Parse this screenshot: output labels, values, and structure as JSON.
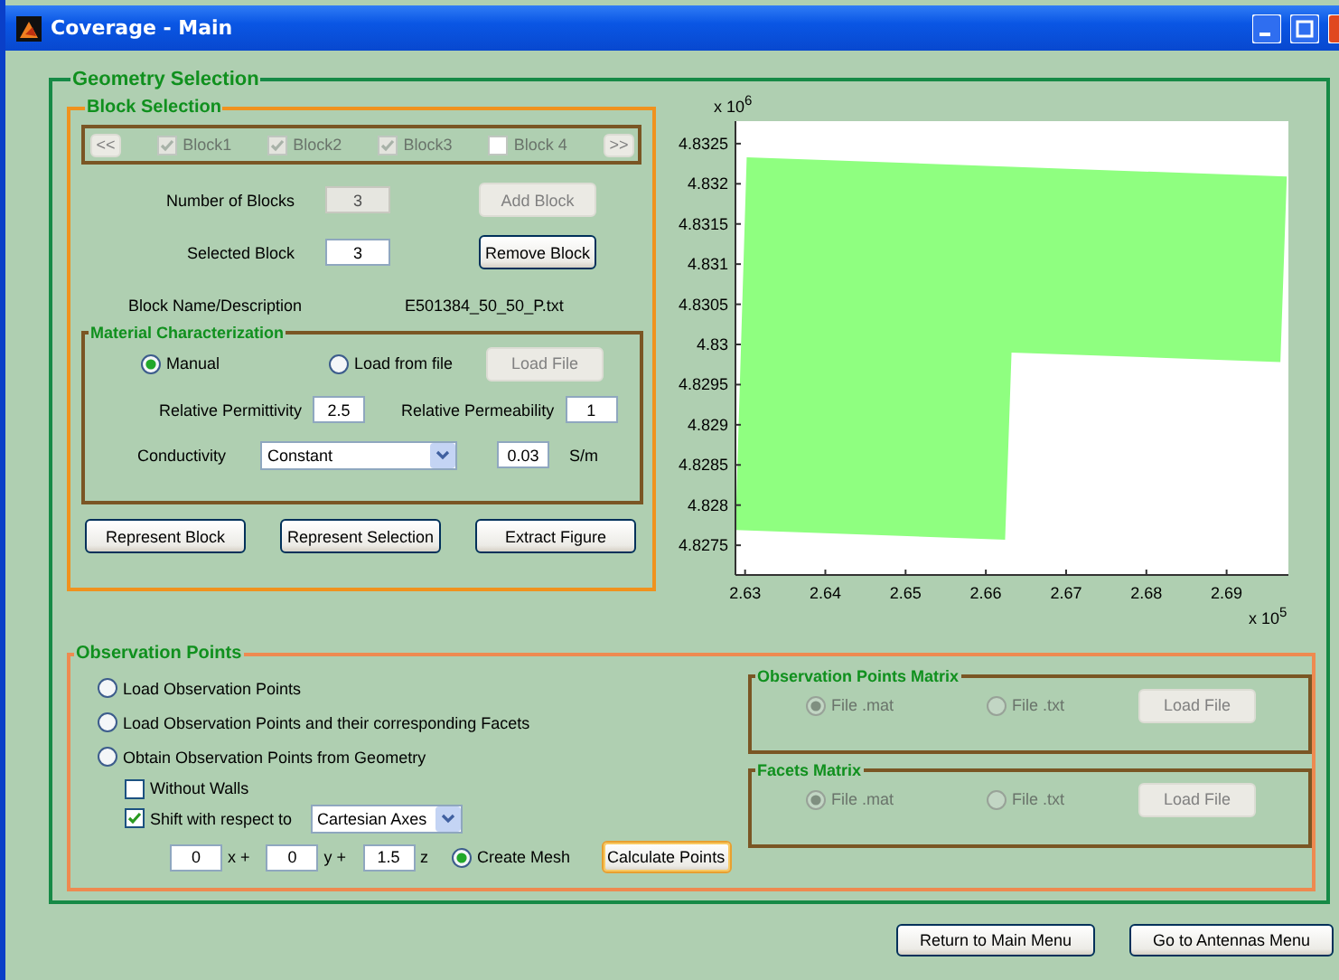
{
  "window": {
    "title": "Coverage - Main"
  },
  "geometry": {
    "title": "Geometry Selection",
    "block_selection": {
      "title": "Block Selection",
      "nav": {
        "prev": "<<",
        "next": ">>",
        "disabled": true
      },
      "blocks": [
        {
          "label": "Block1",
          "checked": true,
          "disabled": true
        },
        {
          "label": "Block2",
          "checked": true,
          "disabled": true
        },
        {
          "label": "Block3",
          "checked": true,
          "disabled": true
        },
        {
          "label": "Block 4",
          "checked": false,
          "disabled": true
        }
      ],
      "number_of_blocks": {
        "label": "Number of Blocks",
        "value": "3",
        "disabled": true
      },
      "add_block": {
        "label": "Add Block",
        "disabled": true
      },
      "selected_block": {
        "label": "Selected Block",
        "value": "3"
      },
      "remove_block": {
        "label": "Remove Block",
        "disabled": false
      },
      "block_name": {
        "label": "Block Name/Description",
        "value": "E501384_50_50_P.txt"
      },
      "material": {
        "title": "Material Characterization",
        "options": [
          {
            "label": "Manual",
            "selected": true
          },
          {
            "label": "Load from file",
            "selected": false
          }
        ],
        "load_file": {
          "label": "Load File",
          "disabled": true
        },
        "permittivity": {
          "label": "Relative Permittivity",
          "value": "2.5"
        },
        "permeability": {
          "label": "Relative Permeability",
          "value": "1"
        },
        "conductivity": {
          "label": "Conductivity",
          "mode": "Constant",
          "value": "0.03",
          "unit": "S/m"
        }
      },
      "buttons": [
        "Represent Block",
        "Represent Selection",
        "Extract Figure"
      ]
    },
    "plot": {
      "chart_data": {
        "type": "area",
        "x": [
          2.6302,
          2.6975,
          2.6967,
          2.6632,
          2.6624,
          2.6288
        ],
        "series": [
          {
            "color": "#8fff80",
            "values": [
              4.83233,
              4.83209,
              4.82978,
              4.8299,
              4.82757,
              4.82769
            ]
          }
        ],
        "xlim": [
          2.6288,
          2.6977
        ],
        "ylim": [
          4.82713,
          4.83278
        ],
        "xticks": [
          2.63,
          2.64,
          2.65,
          2.66,
          2.67,
          2.68,
          2.69
        ],
        "yticks": [
          4.8275,
          4.828,
          4.8285,
          4.829,
          4.8295,
          4.83,
          4.8305,
          4.831,
          4.8315,
          4.832,
          4.8325
        ],
        "annotations": [
          {
            "text": "x 10$^{6}$"
          },
          {
            "text": "x 10$^{5}$"
          }
        ]
      }
    },
    "observation": {
      "title": "Observation Points",
      "options": [
        {
          "label": "Load Observation Points",
          "selected": false
        },
        {
          "label": "Load Observation Points and their corresponding Facets",
          "selected": false
        },
        {
          "label": "Obtain Observation Points from Geometry",
          "selected": false
        }
      ],
      "without_walls": {
        "label": "Without Walls",
        "checked": false
      },
      "shift": {
        "label": "Shift with respect to",
        "checked": true,
        "axes": "Cartesian Axes"
      },
      "coords": [
        {
          "value": "0",
          "label": "x +"
        },
        {
          "value": "0",
          "label": "y +"
        },
        {
          "value": "1.5",
          "label": "z"
        }
      ],
      "create_mesh": {
        "label": "Create Mesh",
        "selected": true
      },
      "calculate": {
        "label": "Calculate Points",
        "focused": true
      },
      "matrices": [
        {
          "title": "Observation Points Matrix",
          "disabled": true,
          "options": [
            {
              "label": "File .mat",
              "selected": true
            },
            {
              "label": "File .txt",
              "selected": false
            }
          ],
          "button": "Load File"
        },
        {
          "title": "Facets Matrix",
          "disabled": true,
          "options": [
            {
              "label": "File .mat",
              "selected": true
            },
            {
              "label": "File .txt",
              "selected": false
            }
          ],
          "button": "Load File"
        }
      ]
    }
  },
  "footer": [
    "Return to Main Menu",
    "Go to Antennas Menu"
  ]
}
